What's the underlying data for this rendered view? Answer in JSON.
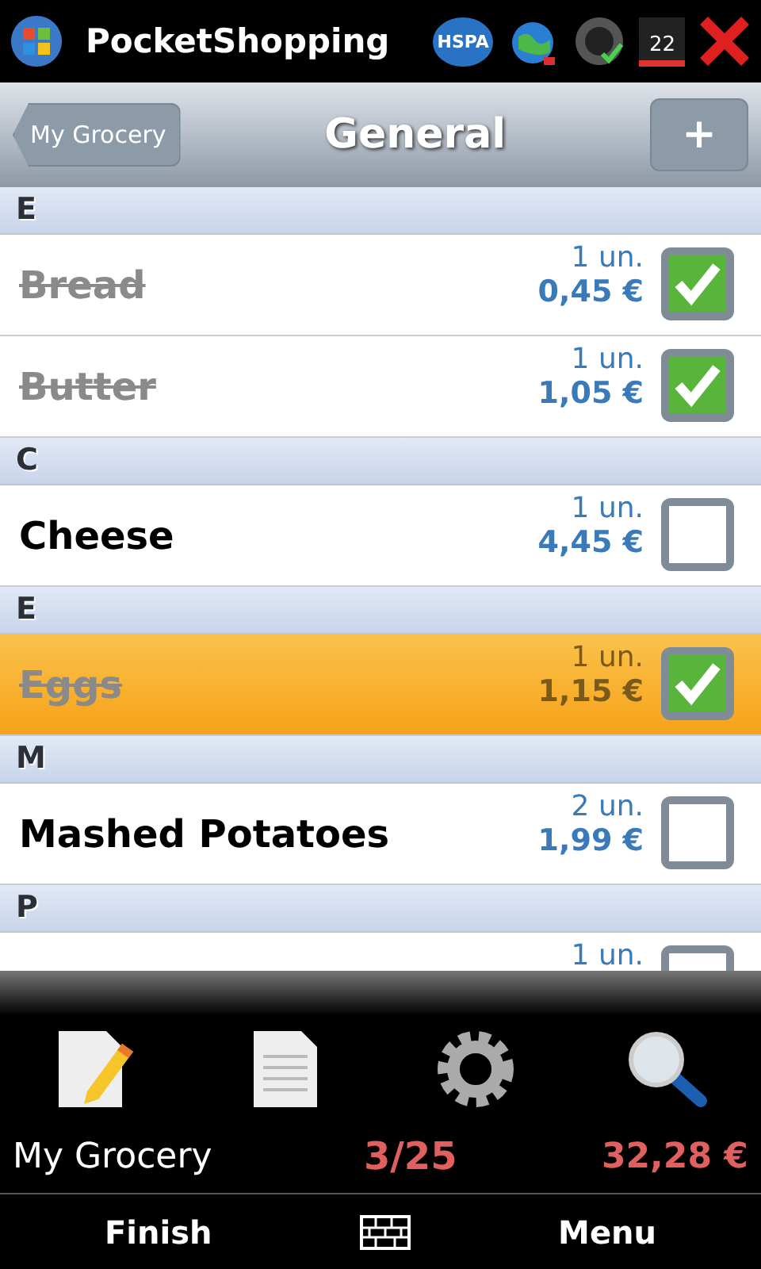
{
  "status_bar": {
    "app_title": "PocketShopping",
    "network": "HSPA",
    "date": "22"
  },
  "header": {
    "back_button": "My Grocery",
    "title": "General",
    "add_button": "+"
  },
  "sections": [
    {
      "letter": "E",
      "items": [
        {
          "name": "Bread",
          "quantity": "1 un.",
          "price": "0,45 €",
          "checked": true,
          "selected": false
        },
        {
          "name": "Butter",
          "quantity": "1 un.",
          "price": "1,05 €",
          "checked": true,
          "selected": false
        }
      ]
    },
    {
      "letter": "C",
      "items": [
        {
          "name": "Cheese",
          "quantity": "1 un.",
          "price": "4,45 €",
          "checked": false,
          "selected": false
        }
      ]
    },
    {
      "letter": "E",
      "items": [
        {
          "name": "Eggs",
          "quantity": "1 un.",
          "price": "1,15 €",
          "checked": true,
          "selected": true
        }
      ]
    },
    {
      "letter": "M",
      "items": [
        {
          "name": "Mashed Potatoes",
          "quantity": "2 un.",
          "price": "1,99 €",
          "checked": false,
          "selected": false
        }
      ]
    },
    {
      "letter": "P",
      "items": [
        {
          "quantity": "1 un.",
          "checked": false,
          "selected": false
        }
      ]
    }
  ],
  "summary": {
    "list_name": "My Grocery",
    "count": "3/25",
    "total": "32,28 €"
  },
  "softkeys": {
    "left": "Finish",
    "right": "Menu"
  }
}
